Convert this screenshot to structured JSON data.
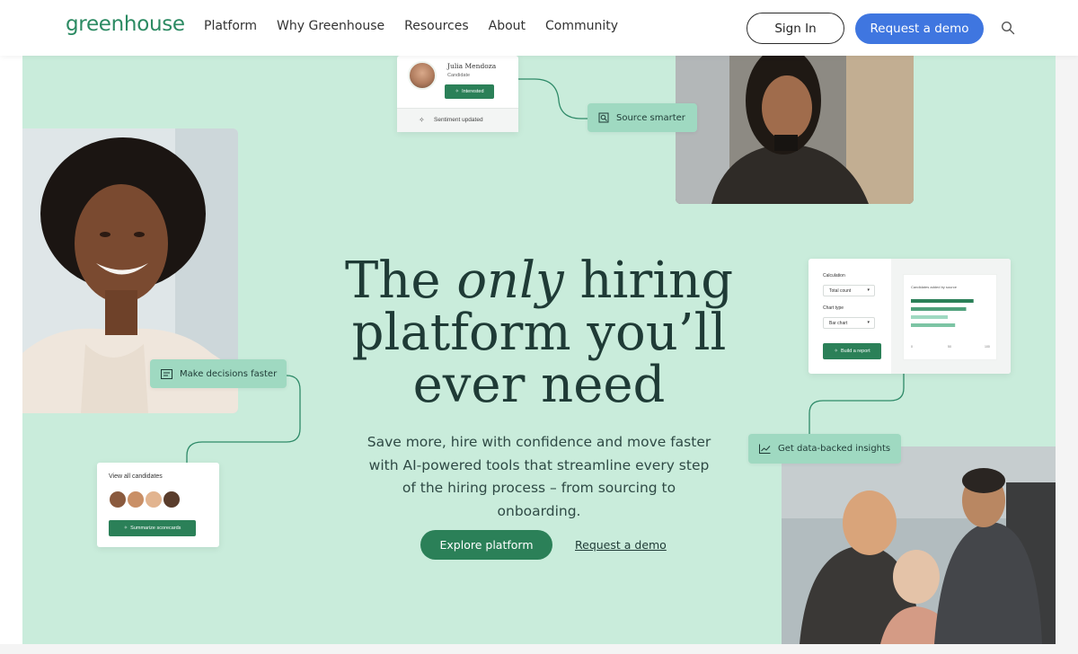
{
  "header": {
    "logo": "greenhouse",
    "nav": [
      "Platform",
      "Why Greenhouse",
      "Resources",
      "About",
      "Community"
    ],
    "sign_in": "Sign In",
    "request_demo": "Request a demo",
    "search_icon": "search-icon"
  },
  "hero": {
    "headline_the": "The",
    "headline_only": "only",
    "headline_rest1": "hiring",
    "headline_line2": "platform you’ll",
    "headline_line3": "ever need",
    "subtext": "Save more, hire with confidence and move faster with AI-powered tools that streamline every step of the hiring process – from sourcing to onboarding.",
    "explore_button": "Explore platform",
    "demo_link": "Request a demo"
  },
  "cards": {
    "candidate": {
      "name": "Julia Mendoza",
      "role": "Candidate",
      "badge": "Interested",
      "footer": "Sentiment updated"
    },
    "source_smarter": "Source smarter",
    "make_decisions": "Make decisions faster",
    "insights": "Get data-backed insights",
    "report": {
      "calculation_label": "Calculation",
      "calculation_value": "Total count",
      "chart_type_label": "Chart type",
      "chart_type_value": "Bar chart",
      "build_button": "Build a report",
      "chart_title": "Candidates added by source",
      "bar_fractions": [
        0.85,
        0.75,
        0.5,
        0.6
      ],
      "ticks": [
        "0",
        "50",
        "100"
      ]
    },
    "candidates": {
      "title": "View all candidates",
      "button": "Summarize scorecards"
    }
  },
  "colors": {
    "hero_bg": "#c9ecdb",
    "brand_green": "#2b8058",
    "pill_green": "#9fd9c1",
    "blue_button": "#3f76e0"
  }
}
